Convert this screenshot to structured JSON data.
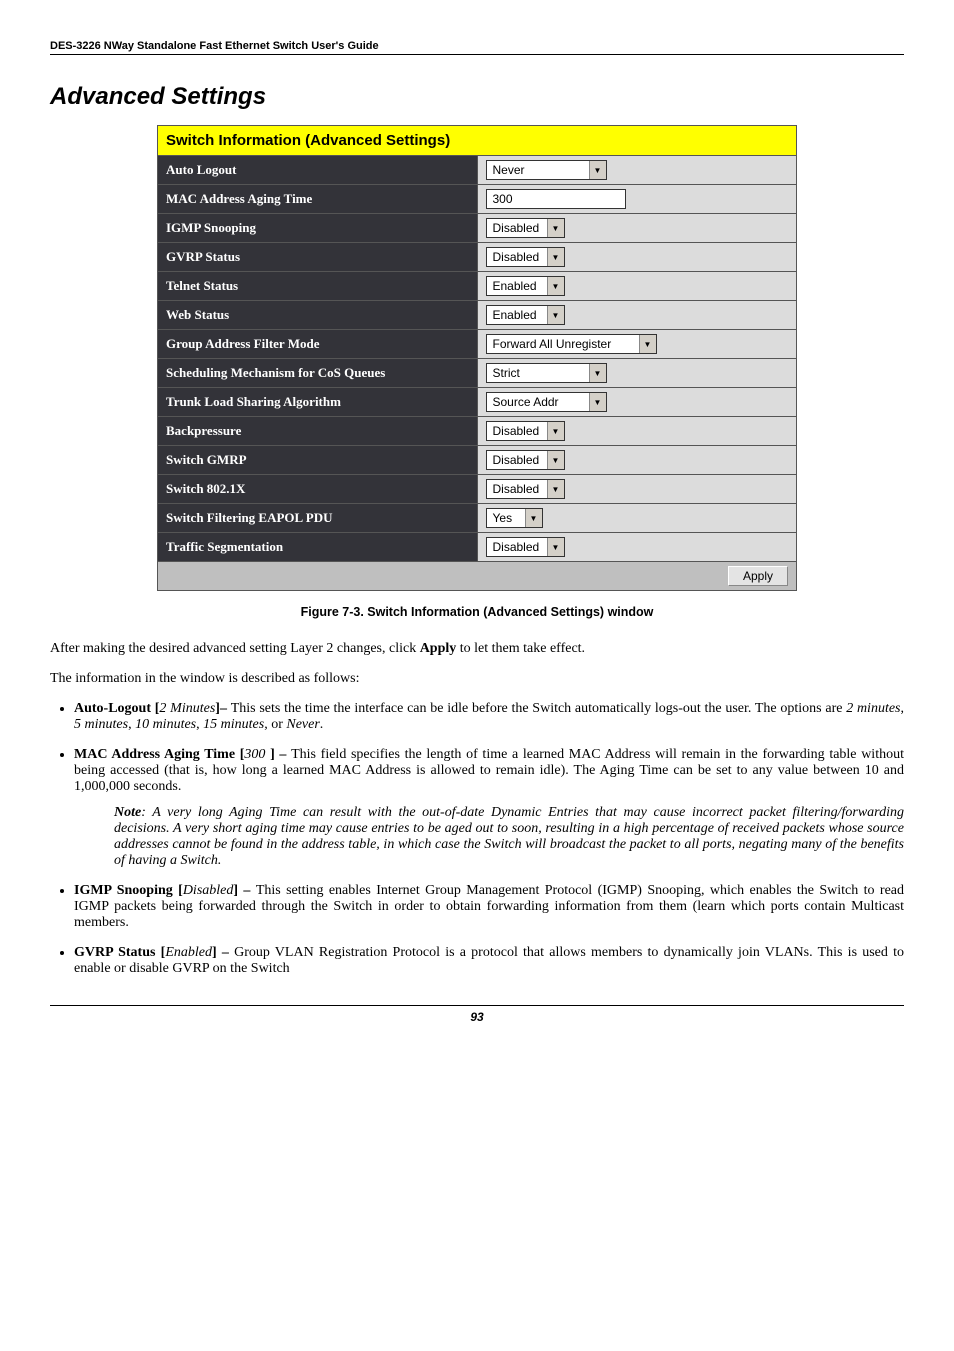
{
  "header": "DES-3226 NWay Standalone Fast Ethernet Switch User's Guide",
  "section_title": "Advanced Settings",
  "panel": {
    "title": "Switch Information (Advanced Settings)",
    "rows": [
      {
        "label": "Auto Logout",
        "type": "dropdown",
        "value": "Never",
        "width": "mid"
      },
      {
        "label": "MAC Address Aging Time",
        "type": "text",
        "value": "300"
      },
      {
        "label": "IGMP Snooping",
        "type": "dropdown",
        "value": "Disabled",
        "width": ""
      },
      {
        "label": "GVRP Status",
        "type": "dropdown",
        "value": "Disabled",
        "width": ""
      },
      {
        "label": "Telnet Status",
        "type": "dropdown",
        "value": "Enabled",
        "width": ""
      },
      {
        "label": "Web Status",
        "type": "dropdown",
        "value": "Enabled",
        "width": ""
      },
      {
        "label": "Group Address Filter Mode",
        "type": "dropdown",
        "value": "Forward All Unregister",
        "width": "wide"
      },
      {
        "label": "Scheduling Mechanism for CoS Queues",
        "type": "dropdown",
        "value": "Strict",
        "width": "mid"
      },
      {
        "label": "Trunk Load Sharing Algorithm",
        "type": "dropdown",
        "value": "Source Addr",
        "width": "mid"
      },
      {
        "label": "Backpressure",
        "type": "dropdown",
        "value": "Disabled",
        "width": ""
      },
      {
        "label": "Switch GMRP",
        "type": "dropdown",
        "value": "Disabled",
        "width": ""
      },
      {
        "label": "Switch 802.1X",
        "type": "dropdown",
        "value": "Disabled",
        "width": ""
      },
      {
        "label": "Switch Filtering EAPOL PDU",
        "type": "dropdown",
        "value": "Yes",
        "width": "narrow"
      },
      {
        "label": "Traffic Segmentation",
        "type": "dropdown",
        "value": "Disabled",
        "width": ""
      }
    ],
    "apply_button": "Apply"
  },
  "figure_caption": "Figure 7-3.  Switch Information (Advanced Settings) window",
  "intro1": "After making the desired advanced setting Layer 2 changes, click ",
  "intro1_bold": "Apply",
  "intro1_end": " to let them take effect.",
  "intro2": "The information in the window is described as follows:",
  "bullets": {
    "b1_strong": "Auto-Logout [",
    "b1_em": "2 Minutes",
    "b1_strong2": "]– ",
    "b1_text": "This sets the time the interface can be idle before the Switch automatically logs-out the user. The options are ",
    "b1_em_a": "2 minutes",
    "b1_em_b": "5 minutes",
    "b1_em_c": "10 minutes",
    "b1_em_d": "15 minutes",
    "b1_em_e": "Never",
    "b2_strong": "MAC Address Aging Time [",
    "b2_em": "300 ",
    "b2_strong2": "] – ",
    "b2_text": "This field specifies the length of time a learned MAC Address will remain in the forwarding table without being accessed (that is, how long a learned MAC Address is allowed to remain idle). The Aging Time can be set to any value between 10 and 1,000,000 seconds.",
    "note_label": "Note",
    "note_text": ": A very long Aging Time can result with the out-of-date Dynamic Entries that may cause incorrect packet filtering/forwarding decisions. A very short aging time may cause entries to be aged out to soon, resulting in a high percentage of received packets whose source addresses cannot be found in the address table, in which case the Switch will broadcast the packet to all ports, negating many of the benefits of having a Switch.",
    "b3_strong": "IGMP Snooping [",
    "b3_em": "Disabled",
    "b3_strong2": "] – ",
    "b3_text": "This setting enables Internet Group Management Protocol (IGMP) Snooping, which enables the Switch to read IGMP packets being forwarded through the Switch in order to obtain forwarding information from them (learn which ports contain Multicast members.",
    "b4_strong": "GVRP Status [",
    "b4_em": "Enabled",
    "b4_strong2": "] – ",
    "b4_text": "Group VLAN Registration Protocol is a protocol that allows members to dynamically join VLANs. This is used to enable or disable GVRP on the Switch"
  },
  "page_number": "93"
}
